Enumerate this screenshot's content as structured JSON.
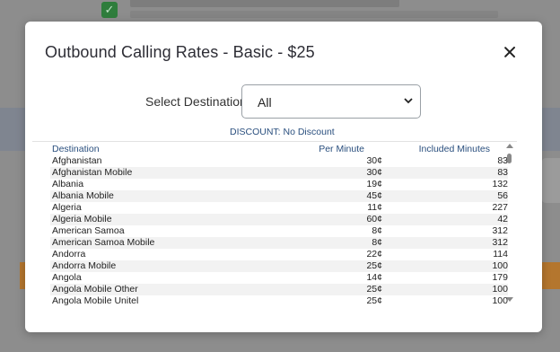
{
  "modal": {
    "title": "Outbound Calling Rates - Basic - $25",
    "close_icon": "close-icon"
  },
  "destination": {
    "label": "Select Destination:",
    "selected": "All"
  },
  "discount_text": "DISCOUNT: No Discount",
  "table": {
    "headers": [
      "Destination",
      "Per Minute",
      "Included Minutes"
    ],
    "rows": [
      [
        "Afghanistan",
        "30¢",
        "83"
      ],
      [
        "Afghanistan Mobile",
        "30¢",
        "83"
      ],
      [
        "Albania",
        "19¢",
        "132"
      ],
      [
        "Albania Mobile",
        "45¢",
        "56"
      ],
      [
        "Algeria",
        "11¢",
        "227"
      ],
      [
        "Algeria Mobile",
        "60¢",
        "42"
      ],
      [
        "American Samoa",
        "8¢",
        "312"
      ],
      [
        "American Samoa Mobile",
        "8¢",
        "312"
      ],
      [
        "Andorra",
        "22¢",
        "114"
      ],
      [
        "Andorra Mobile",
        "25¢",
        "100"
      ],
      [
        "Angola",
        "14¢",
        "179"
      ],
      [
        "Angola Mobile Other",
        "25¢",
        "100"
      ],
      [
        "Angola Mobile Unitel",
        "25¢",
        "100"
      ]
    ]
  },
  "colors": {
    "link_blue": "#2a4f7e",
    "overlay": "#8d8d8d",
    "check_green": "#2f7d3c"
  }
}
